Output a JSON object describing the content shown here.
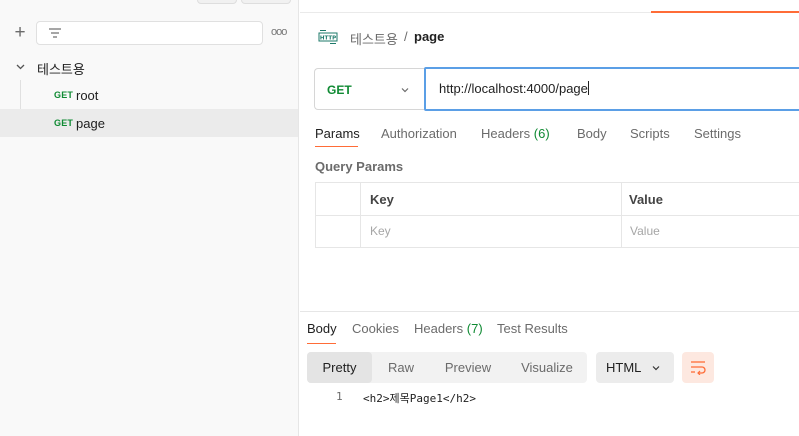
{
  "sidebar": {
    "icons": {
      "add": "plus-icon",
      "filter": "filter-lines-icon",
      "more": "more-dots-icon",
      "expand": "chevron-down-icon"
    },
    "more_label": "ooo",
    "plus_label": "+",
    "collection": {
      "name": "테스트용",
      "expanded": true
    },
    "requests": [
      {
        "method": "GET",
        "name": "root",
        "active": false
      },
      {
        "method": "GET",
        "name": "page",
        "active": true
      }
    ]
  },
  "request": {
    "type_icon": "http-icon",
    "breadcrumb": {
      "collection": "테스트용",
      "separator": "/",
      "request": "page"
    },
    "method": "GET",
    "url": "http://localhost:4000/page",
    "tabs": [
      {
        "label": "Params",
        "active": true
      },
      {
        "label": "Authorization"
      },
      {
        "label": "Headers",
        "count": "(6)"
      },
      {
        "label": "Body"
      },
      {
        "label": "Scripts"
      },
      {
        "label": "Settings"
      }
    ],
    "query_params": {
      "title": "Query Params",
      "columns": [
        "Key",
        "Value"
      ],
      "placeholders": [
        "Key",
        "Value"
      ]
    }
  },
  "response": {
    "tabs": [
      {
        "label": "Body",
        "active": true
      },
      {
        "label": "Cookies"
      },
      {
        "label": "Headers",
        "count": "(7)"
      },
      {
        "label": "Test Results"
      }
    ],
    "view_modes": [
      "Pretty",
      "Raw",
      "Preview",
      "Visualize"
    ],
    "active_view": "Pretty",
    "language": "HTML",
    "wrap_icon": "wrap-lines-icon",
    "code_lines": [
      {
        "number": "1",
        "text": "<h2>제목Page1</h2>"
      }
    ]
  },
  "colors": {
    "accent": "#ff6c37",
    "get_method": "#0f8a33",
    "url_focus": "#5b9fe6"
  }
}
